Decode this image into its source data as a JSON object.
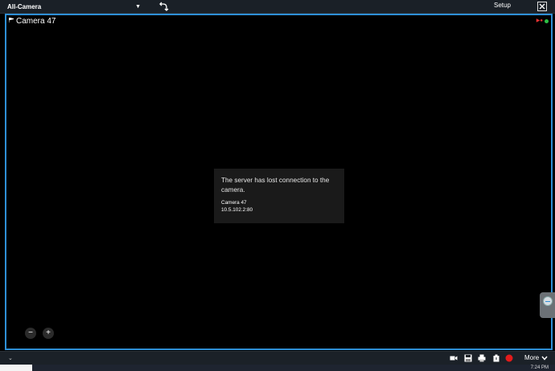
{
  "topbar": {
    "view_name": "All-Camera",
    "setup_label": "Setup"
  },
  "camera": {
    "title": "Camera 47",
    "status_message": "The server has lost connection to the camera.",
    "message_camera_name": "Camera 47",
    "message_address": "10.5.102.2:80"
  },
  "zoom": {
    "zoom_out_label": "−",
    "zoom_in_label": "+"
  },
  "toolbar": {
    "more_label": "More",
    "icons": [
      "video-camera-icon",
      "save-icon",
      "print-icon",
      "bookmark-icon",
      "record-icon"
    ]
  },
  "taskbar": {
    "clock": "7:24 PM"
  },
  "colors": {
    "tile_border": "#2e8fd6",
    "record": "#e21b1b",
    "live_dot": "#2ec045"
  }
}
